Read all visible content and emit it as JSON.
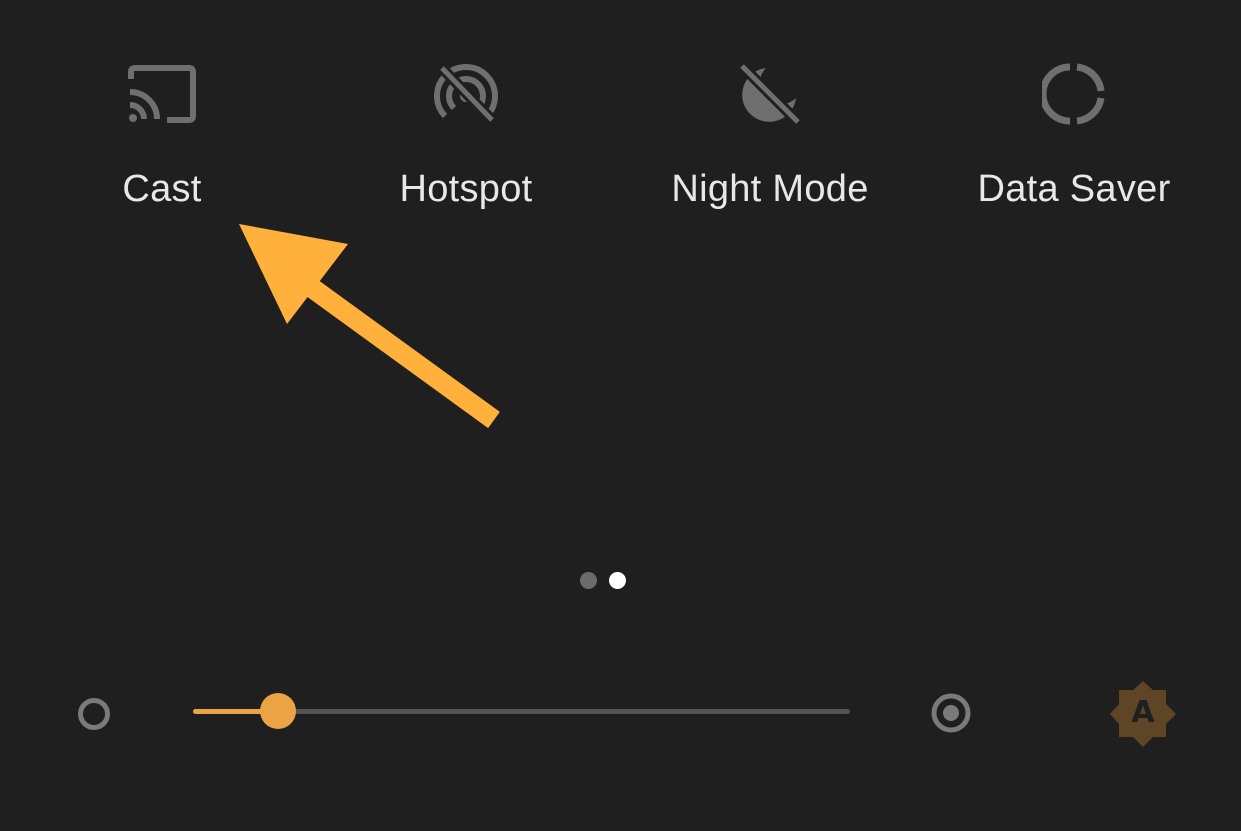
{
  "quick_settings": {
    "tiles": [
      {
        "label": "Cast",
        "icon": "cast-icon"
      },
      {
        "label": "Hotspot",
        "icon": "hotspot-off-icon"
      },
      {
        "label": "Night Mode",
        "icon": "night-mode-off-icon"
      },
      {
        "label": "Data Saver",
        "icon": "data-saver-icon"
      }
    ],
    "page_indicator": {
      "pages": 2,
      "current_page": 2
    }
  },
  "brightness": {
    "level_fraction": 0.13,
    "auto_icon_letter": "A",
    "accent_color": "#eba443"
  },
  "colors": {
    "background": "#1f1f1f",
    "icon_inactive": "#6f6f6f",
    "label": "#e8e8e8",
    "annotation_arrow": "#ffb13b"
  }
}
